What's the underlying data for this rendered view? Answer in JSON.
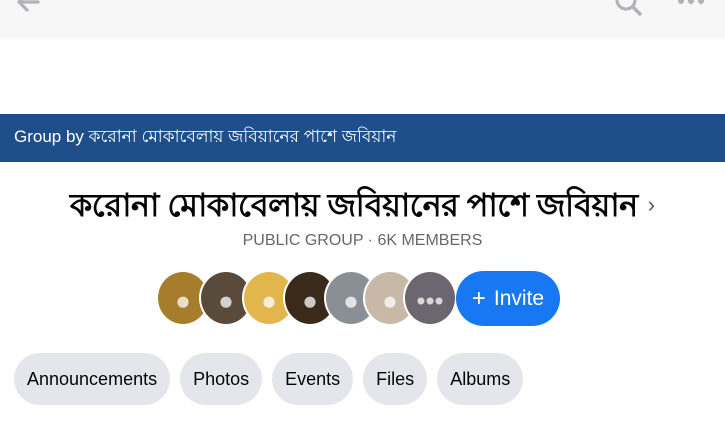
{
  "header": {
    "back_icon": "arrow-left-icon",
    "search_icon": "search-icon",
    "more_icon": "more-horizontal-icon"
  },
  "banner": {
    "text": "Group by করোনা মোকাবেলায় জবিয়ানের পাশে জবিয়ান",
    "background": "#1e4f8a"
  },
  "group": {
    "title": "করোনা মোকাবেলায় জবিয়ানের পাশে জবিয়ান",
    "chevron": "›",
    "meta": "PUBLIC GROUP · 6K MEMBERS"
  },
  "members": {
    "avatars": [
      {
        "color": "#a67c2d"
      },
      {
        "color": "#5a4a3c"
      },
      {
        "color": "#e3b54d"
      },
      {
        "color": "#3a2a1a"
      },
      {
        "color": "#8a8f96"
      },
      {
        "color": "#c8b8a6"
      },
      {
        "color": "#6b6670"
      }
    ]
  },
  "invite": {
    "label": "Invite",
    "plus": "+",
    "color": "#1877f2"
  },
  "tabs": [
    {
      "label": "Announcements"
    },
    {
      "label": "Photos"
    },
    {
      "label": "Events"
    },
    {
      "label": "Files"
    },
    {
      "label": "Albums"
    }
  ]
}
